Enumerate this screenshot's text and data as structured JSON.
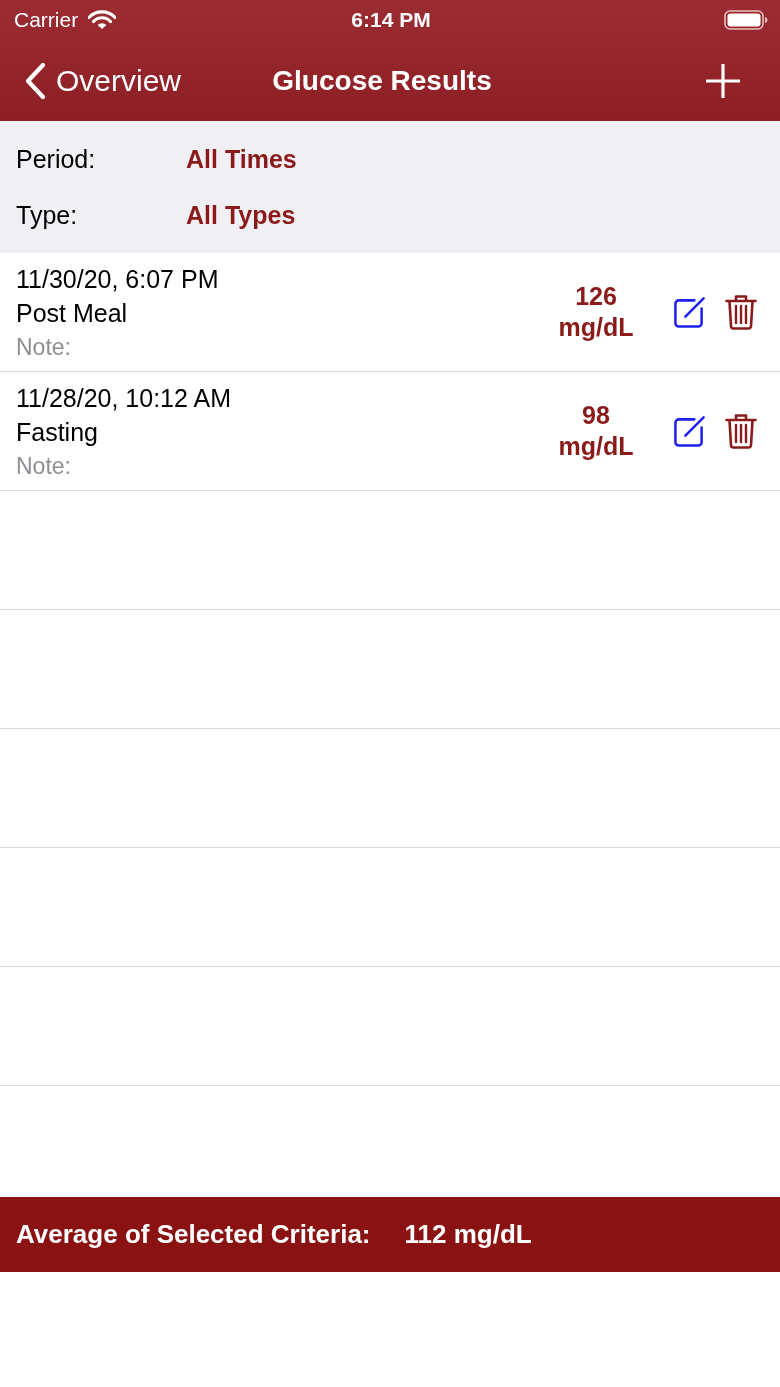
{
  "status_bar": {
    "carrier": "Carrier",
    "time": "6:14 PM"
  },
  "nav_bar": {
    "back_label": "Overview",
    "title": "Glucose Results"
  },
  "filters": [
    {
      "label": "Period:",
      "value": "All Times"
    },
    {
      "label": "Type:",
      "value": "All Types"
    }
  ],
  "results": [
    {
      "datetime": "11/30/20, 6:07 PM",
      "type": "Post Meal",
      "note_label": "Note:",
      "value": "126",
      "unit": "mg/dL"
    },
    {
      "datetime": "11/28/20, 10:12 AM",
      "type": "Fasting",
      "note_label": "Note:",
      "value": "98",
      "unit": "mg/dL"
    }
  ],
  "footer": {
    "label": "Average of Selected Criteria:",
    "value": "112 mg/dL"
  }
}
